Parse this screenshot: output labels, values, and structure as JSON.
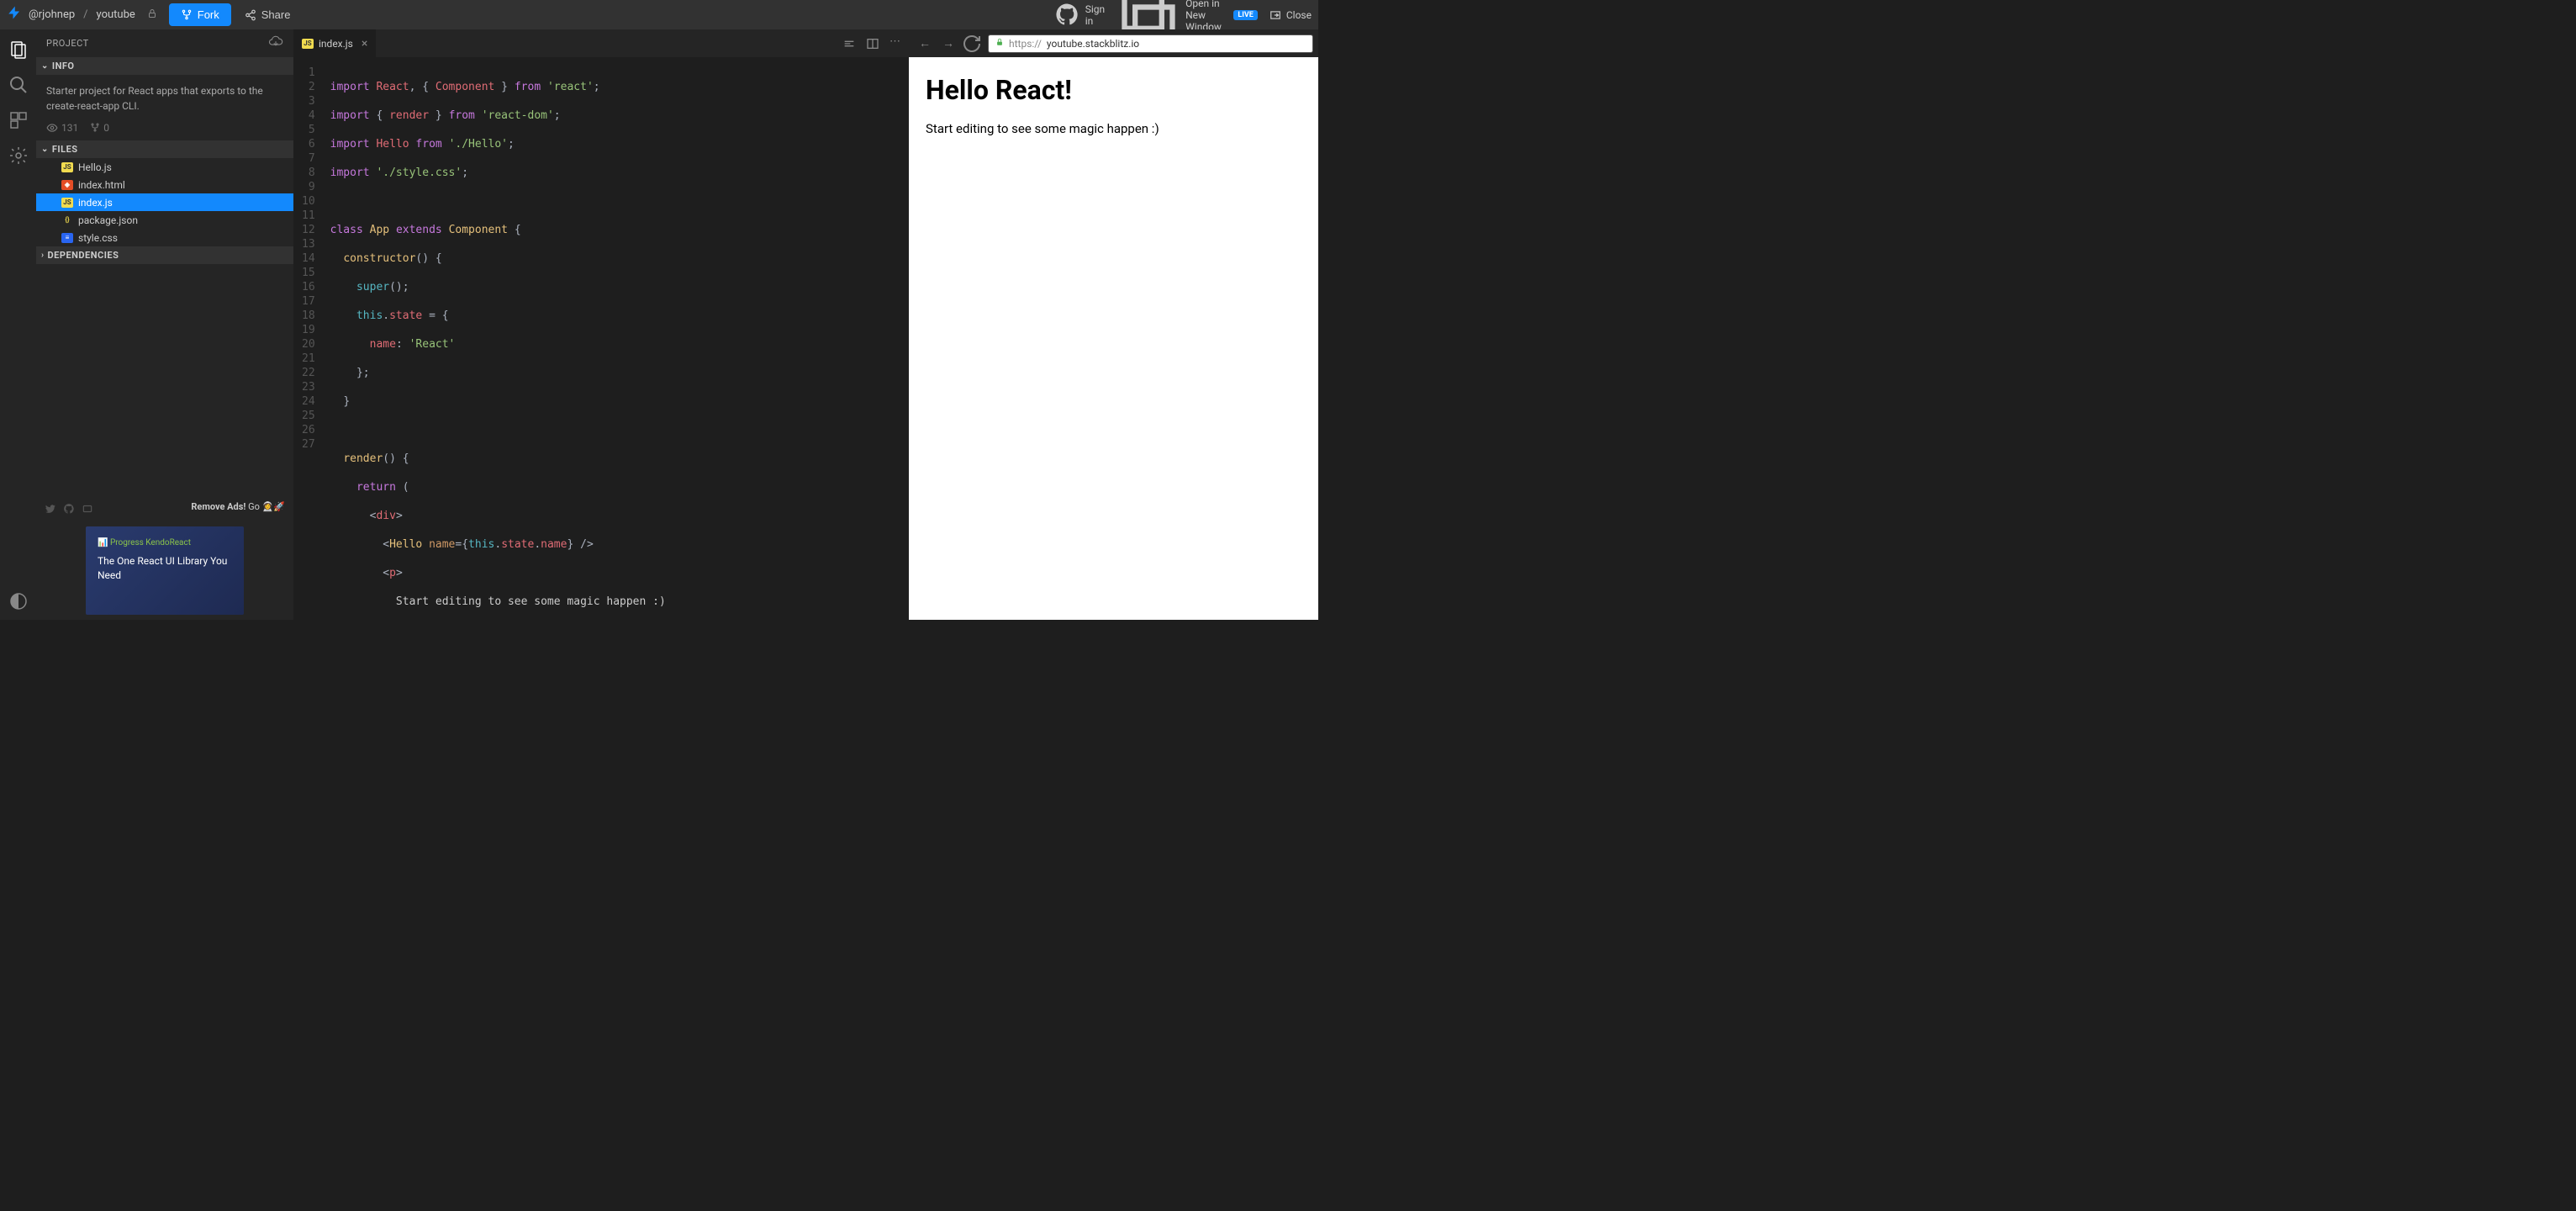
{
  "topbar": {
    "user": "@rjohnep",
    "project": "youtube",
    "fork": "Fork",
    "share": "Share",
    "signin": "Sign in",
    "open_new": "Open in New Window",
    "live": "LIVE",
    "close": "Close"
  },
  "sidebar": {
    "header": "PROJECT",
    "info_title": "INFO",
    "info_text": "Starter project for React apps that exports to the create-react-app CLI.",
    "views": "131",
    "forks": "0",
    "files_title": "FILES",
    "files": [
      {
        "name": "Hello.js",
        "type": "js"
      },
      {
        "name": "index.html",
        "type": "html"
      },
      {
        "name": "index.js",
        "type": "js"
      },
      {
        "name": "package.json",
        "type": "json"
      },
      {
        "name": "style.css",
        "type": "css"
      }
    ],
    "deps_title": "DEPENDENCIES",
    "remove_ads": "Remove Ads!",
    "go": " Go ",
    "ad_logo": "Progress KendoReact",
    "ad_text": "The One React UI Library You Need"
  },
  "editor": {
    "tab_name": "index.js",
    "lines": 27
  },
  "preview": {
    "url_prefix": "https://",
    "url_main": "youtube.stackblitz.io",
    "heading": "Hello React!",
    "paragraph": "Start editing to see some magic happen :)"
  }
}
